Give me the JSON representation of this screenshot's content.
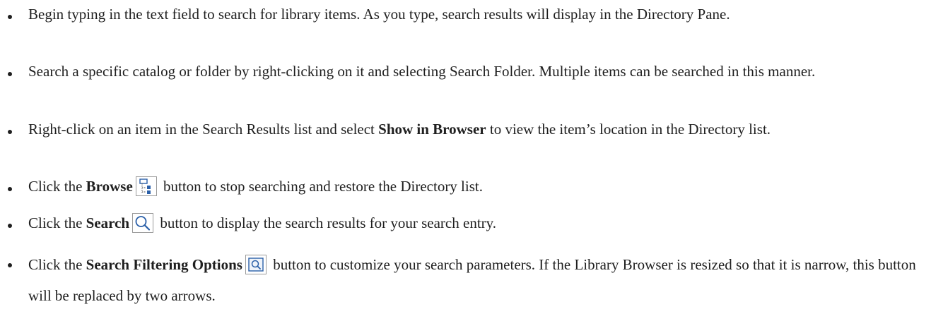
{
  "bullets": [
    {
      "text": "Begin typing in the text field to search for library items. As you type, search results will display in the Directory Pane."
    },
    {
      "text": "Search a specific catalog or folder by right-clicking on it and selecting Search Folder. Multiple items can be searched in this manner."
    },
    {
      "pre": "Right-click on an item in the Search Results list and select ",
      "bold": "Show in Browser",
      "post": " to view the item’s location in the Directory list."
    },
    {
      "pre": "Click the ",
      "bold": "Browse",
      "icon": "browse-icon",
      "post": " button to stop searching and restore the Directory list."
    },
    {
      "pre": "Click the ",
      "bold": "Search",
      "icon": "search-icon",
      "post": " button to display the search results for your search entry."
    },
    {
      "pre": "Click the ",
      "bold": "Search Filtering Options",
      "icon": "search-filter-icon",
      "post": " button to customize your search parameters. If the Library Browser is resized so that it is narrow, this button will be replaced by two arrows."
    }
  ]
}
